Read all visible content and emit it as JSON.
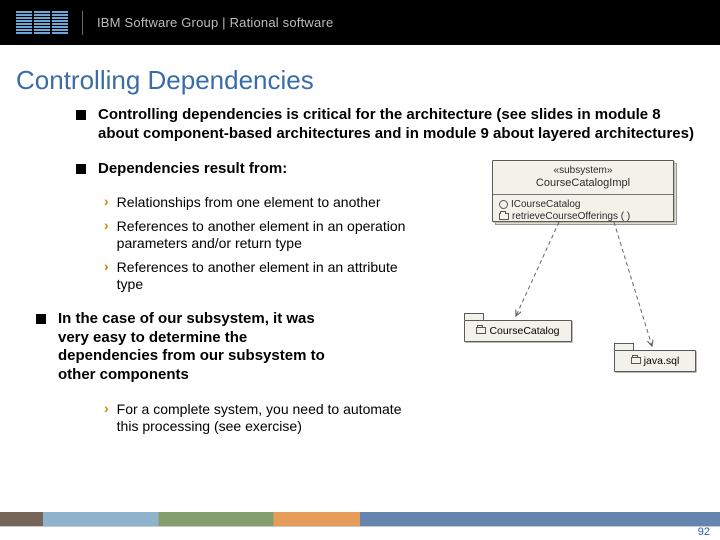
{
  "header": {
    "breadcrumb": "IBM Software Group | Rational software"
  },
  "title": "Controlling Dependencies",
  "bullets": {
    "b1": "Controlling dependencies is critical for the architecture (see slides in module 8 about component-based architectures and in module 9 about layered architectures)",
    "b2": "Dependencies result from:",
    "b2_subs": {
      "s1": "Relationships from one element to another",
      "s2": "References to another element in an operation parameters and/or return type",
      "s3": "References to another element in an attribute type"
    },
    "b3": "In the case of our subsystem, it was very easy to determine the dependencies from our subsystem to other components",
    "b3_subs": {
      "s1": "For a complete system, you need to automate this processing (see exercise)"
    }
  },
  "diagram": {
    "stereotype": "«subsystem»",
    "class_name": "CourseCatalogImpl",
    "op1": "ICourseCatalog",
    "op2": "retrieveCourseOfferings ( )",
    "pkg_left": "CourseCatalog",
    "pkg_right": "java.sql"
  },
  "footer": {
    "page": "92"
  }
}
